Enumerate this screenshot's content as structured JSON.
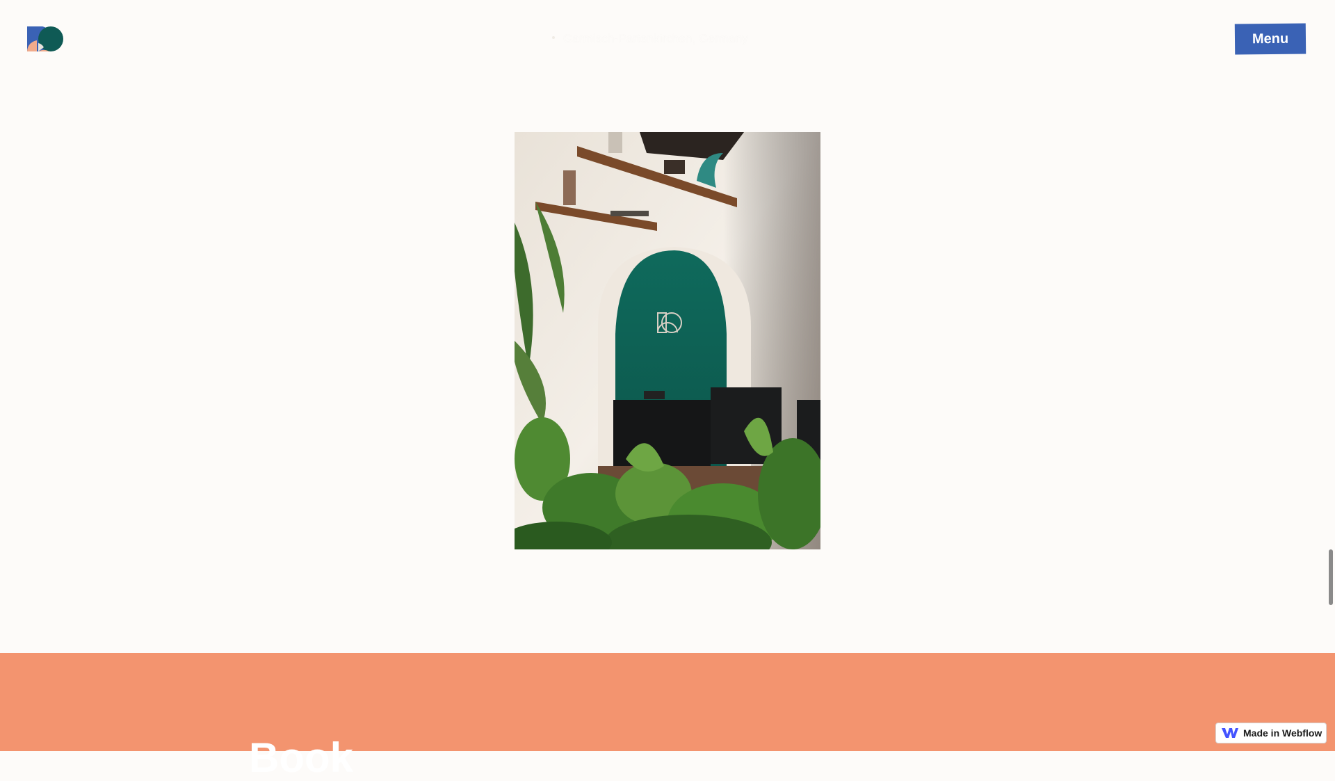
{
  "header": {
    "logo_name": "brand-logo",
    "location_icon": "map-pin-icon",
    "location_text": "Garmisch-Partenkirchen, Germany",
    "menu_label": "Menu"
  },
  "photo": {
    "subject": "office-arch-photo"
  },
  "section": {
    "heading_partial": "Book"
  },
  "badge": {
    "icon": "webflow-icon",
    "label": "Made in Webflow"
  },
  "colors": {
    "background": "#fdfbf9",
    "menu_button": "#3a62b5",
    "coral": "#f3946f",
    "logo_blue": "#3a62b5",
    "logo_teal": "#0f5a55",
    "logo_peach": "#f2ab8b"
  }
}
